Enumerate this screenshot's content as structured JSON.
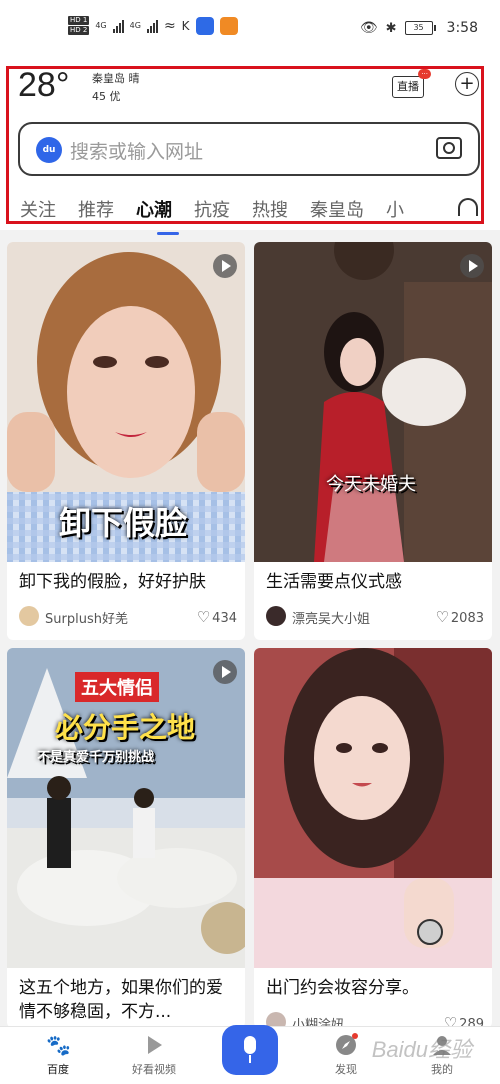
{
  "status_bar": {
    "hd1": "HD 1",
    "hd2": "HD 2",
    "net1": "4G",
    "net2": "4G",
    "battery": "35",
    "time": "3:58"
  },
  "weather": {
    "temperature": "28°",
    "city": "秦皇岛 晴",
    "aqi": "45 优"
  },
  "header": {
    "live_label": "直播",
    "live_badge": "···",
    "plus_label": "+"
  },
  "search": {
    "logo": "du",
    "placeholder": "搜索或输入网址"
  },
  "tabs": [
    {
      "label": "关注"
    },
    {
      "label": "推荐"
    },
    {
      "label": "心潮"
    },
    {
      "label": "抗疫"
    },
    {
      "label": "热搜"
    },
    {
      "label": "秦皇岛"
    },
    {
      "label": "小"
    }
  ],
  "feed": [
    {
      "title": "卸下我的假脸，好好护肤",
      "overlay": "卸下假脸",
      "author": "Surplush好羌",
      "likes": "434"
    },
    {
      "title": "生活需要点仪式感",
      "overlay": "今天未婚夫",
      "author": "漂亮吴大小姐",
      "likes": "2083"
    },
    {
      "title": "这五个地方，如果你们的爱情不够稳固，不方...",
      "overlay_line1": "五大情侣",
      "overlay_line2": "必分手之地",
      "overlay_line3": "不是真爱千万别挑战",
      "author": "",
      "likes": ""
    },
    {
      "title": "出门约会妆容分享。",
      "author": "小糊涂妞",
      "likes": "289"
    }
  ],
  "bottom_nav": [
    {
      "label": "百度"
    },
    {
      "label": "好看视频"
    },
    {
      "label": ""
    },
    {
      "label": "发现"
    },
    {
      "label": "我的"
    }
  ],
  "watermark": "Baidu经验",
  "colors": {
    "accent": "#3565e8",
    "highlight_box": "#d9121c"
  }
}
